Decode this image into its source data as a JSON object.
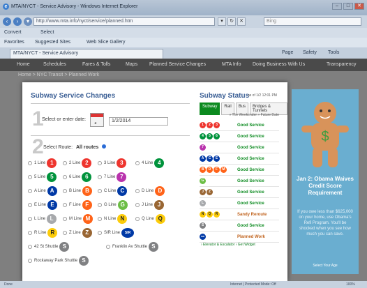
{
  "browser": {
    "title": "MTA/NYCT - Service Advisory - Windows Internet Explorer",
    "url": "http://www.mta.info/nyct/service/planned.htm",
    "search_placeholder": "Bing",
    "menu": [
      "Convert",
      "Select"
    ],
    "favorites": [
      "Favorites",
      "Suggested Sites",
      "Web Slice Gallery"
    ],
    "tab_label": "MTA/NYCT - Service Advisory",
    "tab_tools": [
      "Page",
      "Safety",
      "Tools"
    ],
    "status_left": "Done",
    "status_right": "Internet | Protected Mode: Off",
    "zoom": "100%"
  },
  "site_nav": [
    "Home",
    "Schedules",
    "Fares & Tolls",
    "Maps",
    "Planned Service Changes",
    "MTA Info",
    "Doing Business With Us",
    "Transparency"
  ],
  "breadcrumb": "Home > NYC Transit > Planned Work",
  "changes": {
    "title": "Subway Service Changes",
    "step1_num": "1",
    "step1_label": "Select or enter date:",
    "date_value": "1/2/2014",
    "step2_num": "2",
    "step2_label": "Select Route:",
    "all_routes": "All routes"
  },
  "routes": [
    {
      "label": "1 Line",
      "sym": "1",
      "color": "#ee352e"
    },
    {
      "label": "2 Line",
      "sym": "2",
      "color": "#ee352e"
    },
    {
      "label": "3 Line",
      "sym": "3",
      "color": "#ee352e"
    },
    {
      "label": "4 Line",
      "sym": "4",
      "color": "#00933c"
    },
    {
      "label": "5 Line",
      "sym": "5",
      "color": "#00933c"
    },
    {
      "label": "6 Line",
      "sym": "6",
      "color": "#00933c"
    },
    {
      "label": "7 Line",
      "sym": "7",
      "color": "#b933ad"
    },
    {
      "label": "A Line",
      "sym": "A",
      "color": "#0039a6"
    },
    {
      "label": "B Line",
      "sym": "B",
      "color": "#ff6319"
    },
    {
      "label": "C Line",
      "sym": "C",
      "color": "#0039a6"
    },
    {
      "label": "D Line",
      "sym": "D",
      "color": "#ff6319"
    },
    {
      "label": "E Line",
      "sym": "E",
      "color": "#0039a6"
    },
    {
      "label": "F Line",
      "sym": "F",
      "color": "#ff6319"
    },
    {
      "label": "G Line",
      "sym": "G",
      "color": "#6cbe45"
    },
    {
      "label": "J Line",
      "sym": "J",
      "color": "#996633"
    },
    {
      "label": "L Line",
      "sym": "L",
      "color": "#a7a9ac"
    },
    {
      "label": "M Line",
      "sym": "M",
      "color": "#ff6319"
    },
    {
      "label": "N Line",
      "sym": "N",
      "color": "#fccc0a"
    },
    {
      "label": "Q Line",
      "sym": "Q",
      "color": "#fccc0a"
    },
    {
      "label": "R Line",
      "sym": "R",
      "color": "#fccc0a"
    },
    {
      "label": "Z Line",
      "sym": "Z",
      "color": "#996633"
    },
    {
      "label": "SIR Line",
      "sym": "SIR",
      "color": "#0039a6"
    },
    {
      "label": "42 St Shuttle",
      "sym": "S",
      "color": "#808183"
    },
    {
      "label": "Franklin Av Shuttle",
      "sym": "S",
      "color": "#808183"
    },
    {
      "label": "Rockaway Park Shuttle",
      "sym": "S",
      "color": "#808183"
    }
  ],
  "status": {
    "title": "Subway Status",
    "as_of": "as of 1/2 12:01 PM",
    "tabs": [
      "Subway",
      "Rail",
      "Bus",
      "Bridges & Tunnels"
    ],
    "legend": "» The Weekender » Future Date",
    "rows": [
      {
        "lines": [
          [
            "1",
            "#ee352e"
          ],
          [
            "2",
            "#ee352e"
          ],
          [
            "3",
            "#ee352e"
          ]
        ],
        "text": "Good Service",
        "warn": false
      },
      {
        "lines": [
          [
            "4",
            "#00933c"
          ],
          [
            "5",
            "#00933c"
          ],
          [
            "6",
            "#00933c"
          ]
        ],
        "text": "Good Service",
        "warn": false
      },
      {
        "lines": [
          [
            "7",
            "#b933ad"
          ]
        ],
        "text": "Good Service",
        "warn": false
      },
      {
        "lines": [
          [
            "A",
            "#0039a6"
          ],
          [
            "C",
            "#0039a6"
          ],
          [
            "E",
            "#0039a6"
          ]
        ],
        "text": "Good Service",
        "warn": false
      },
      {
        "lines": [
          [
            "B",
            "#ff6319"
          ],
          [
            "D",
            "#ff6319"
          ],
          [
            "F",
            "#ff6319"
          ],
          [
            "M",
            "#ff6319"
          ]
        ],
        "text": "Good Service",
        "warn": false
      },
      {
        "lines": [
          [
            "G",
            "#6cbe45"
          ]
        ],
        "text": "Good Service",
        "warn": false
      },
      {
        "lines": [
          [
            "J",
            "#996633"
          ],
          [
            "Z",
            "#996633"
          ]
        ],
        "text": "Good Service",
        "warn": false
      },
      {
        "lines": [
          [
            "L",
            "#a7a9ac"
          ]
        ],
        "text": "Good Service",
        "warn": false
      },
      {
        "lines": [
          [
            "N",
            "#fccc0a"
          ],
          [
            "Q",
            "#fccc0a"
          ],
          [
            "R",
            "#fccc0a"
          ]
        ],
        "text": "Sandy Reroute",
        "warn": true
      },
      {
        "lines": [
          [
            "S",
            "#808183"
          ]
        ],
        "text": "Good Service",
        "warn": false
      },
      {
        "lines": [
          [
            "SIR",
            "#0039a6"
          ]
        ],
        "text": "Planned Work",
        "warn": true
      }
    ],
    "footer": "› Elevator & Escalator  › Get Widget"
  },
  "ad": {
    "headline": "Jan 2: Obama Waives Credit Score Requirement",
    "body": "If you owe less than $625,000 on your home, use Obama's Refi Program. You'll be shocked when you see how much you can save.",
    "cta": "Select Your Age"
  },
  "colors": {
    "accent": "#3b5f95",
    "good": "#0b8a1f",
    "warn": "#c0621c"
  }
}
